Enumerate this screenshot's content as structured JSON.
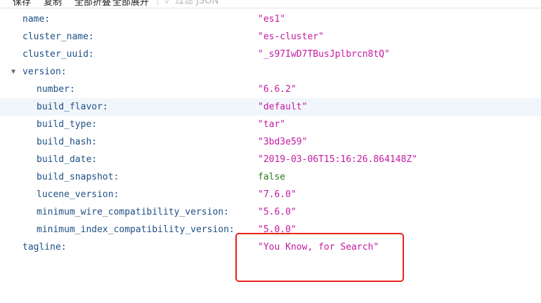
{
  "toolbar": {
    "save_label": "保存",
    "copy_label": "复制",
    "collapse_all_label": "全部折叠",
    "expand_all_label": "全部展开",
    "filter_placeholder": "过滤 JSON"
  },
  "json": {
    "rows": [
      {
        "key": "name:",
        "value": "\"es1\"",
        "type": "string"
      },
      {
        "key": "cluster_name:",
        "value": "\"es-cluster\"",
        "type": "string"
      },
      {
        "key": "cluster_uuid:",
        "value": "\"_s97IwD7TBusJplbrcn8tQ\"",
        "type": "string"
      },
      {
        "key": "version:",
        "value": "",
        "type": "object"
      },
      {
        "key": "number:",
        "value": "\"6.6.2\"",
        "type": "string"
      },
      {
        "key": "build_flavor:",
        "value": "\"default\"",
        "type": "string"
      },
      {
        "key": "build_type:",
        "value": "\"tar\"",
        "type": "string"
      },
      {
        "key": "build_hash:",
        "value": "\"3bd3e59\"",
        "type": "string"
      },
      {
        "key": "build_date:",
        "value": "\"2019-03-06T15:16:26.864148Z\"",
        "type": "string"
      },
      {
        "key": "build_snapshot:",
        "value": "false",
        "type": "boolean"
      },
      {
        "key": "lucene_version:",
        "value": "\"7.6.0\"",
        "type": "string"
      },
      {
        "key": "minimum_wire_compatibility_version:",
        "value": "\"5.6.0\"",
        "type": "string"
      },
      {
        "key": "minimum_index_compatibility_version:",
        "value": "\"5.0.0\"",
        "type": "string"
      },
      {
        "key": "tagline:",
        "value": "\"You Know, for Search\"",
        "type": "string"
      }
    ]
  },
  "colors": {
    "key": "#1e4f86",
    "string": "#c41aa1",
    "boolean": "#2b7a1a",
    "row_highlight": "#f1f6fb",
    "annotation_border": "#e8221b"
  },
  "icons": {
    "expand_toggle": "triangle-down-icon",
    "filter": "filter-icon"
  }
}
